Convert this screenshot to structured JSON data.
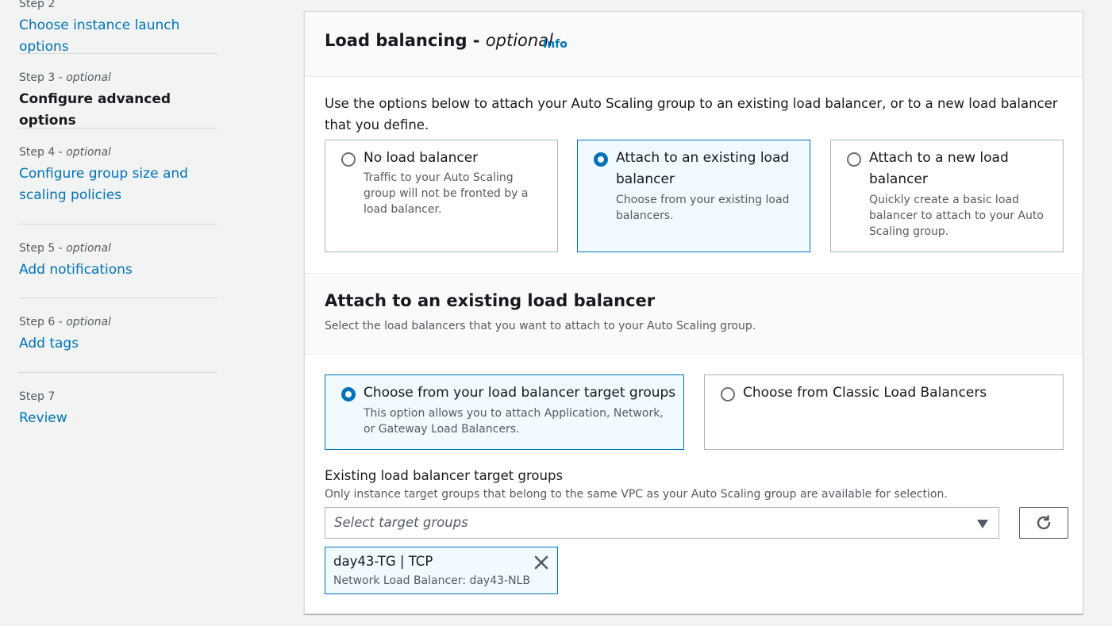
{
  "nav": {
    "steps": [
      {
        "label": "Step 2",
        "optional": "",
        "title": "Choose instance launch options"
      },
      {
        "label": "Step 3 - ",
        "optional": "optional",
        "title": "Configure advanced options"
      },
      {
        "label": "Step 4 - ",
        "optional": "optional",
        "title_line1": "Configure group size and",
        "title_line2": "scaling policies"
      },
      {
        "label": "Step 5 - ",
        "optional": "optional",
        "title": "Add notifications"
      },
      {
        "label": "Step 6 - ",
        "optional": "optional",
        "title": "Add tags"
      },
      {
        "label": "Step 7",
        "optional": "",
        "title": "Review"
      }
    ]
  },
  "load_balancing": {
    "title": "Load balancing - ",
    "title_optional": "optional",
    "info": "Info",
    "description": "Use the options below to attach your Auto Scaling group to an existing load balancer, or to a new load balancer that you define.",
    "options": [
      {
        "title": "No load balancer",
        "desc": "Traffic to your Auto Scaling group will not be fronted by a load balancer.",
        "selected": false
      },
      {
        "title": "Attach to an existing load balancer",
        "desc": "Choose from your existing load balancers.",
        "selected": true
      },
      {
        "title": "Attach to a new load balancer",
        "desc": "Quickly create a basic load balancer to attach to your Auto Scaling group.",
        "selected": false
      }
    ]
  },
  "existing": {
    "title": "Attach to an existing load balancer",
    "description": "Select the load balancers that you want to attach to your Auto Scaling group.",
    "options": [
      {
        "title": "Choose from your load balancer target groups",
        "desc": "This option allows you to attach Application, Network, or Gateway Load Balancers.",
        "selected": true
      },
      {
        "title": "Choose from Classic Load Balancers",
        "desc": "",
        "selected": false
      }
    ],
    "field_label": "Existing load balancer target groups",
    "field_desc": "Only instance target groups that belong to the same VPC as your Auto Scaling group are available for selection.",
    "select_placeholder": "Select target groups",
    "token": {
      "title": "day43-TG | TCP",
      "subtitle": "Network Load Balancer: day43-NLB"
    }
  },
  "icons": {
    "refresh": "refresh-icon",
    "remove": "close-icon",
    "dropdown": "caret-down-icon"
  },
  "colors": {
    "link": "#0073bb",
    "selected_bg": "#f1faff",
    "border": "#aab7b8"
  }
}
